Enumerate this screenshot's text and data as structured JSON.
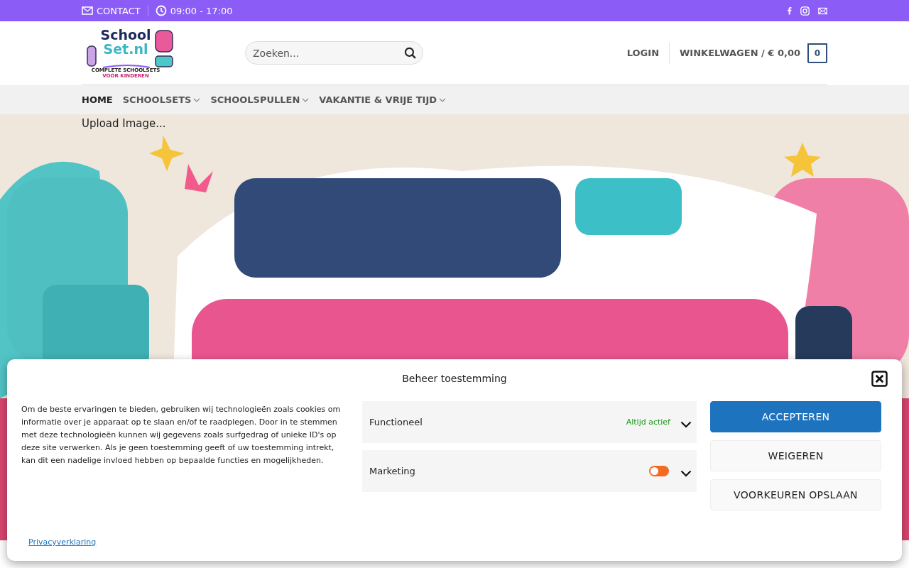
{
  "top_bar": {
    "contact": "CONTACT",
    "hours": "09:00 - 17:00"
  },
  "logo": {
    "line_1": "School",
    "line_2": "Set.nl",
    "tagline_1": "COMPLETE SCHOOLSETS",
    "tagline_2": "VOOR KINDEREN"
  },
  "search": {
    "placeholder": "Zoeken..."
  },
  "account": {
    "login": "LOGIN",
    "cart": "WINKELWAGEN / € 0,00",
    "cart_count": "0"
  },
  "nav": [
    {
      "label": "HOME",
      "selected": true,
      "dropdown": false
    },
    {
      "label": "SCHOOLSETS",
      "selected": false,
      "dropdown": true
    },
    {
      "label": "SCHOOLSPULLEN",
      "selected": false,
      "dropdown": true
    },
    {
      "label": "VAKANTIE & VRIJE TIJD",
      "selected": false,
      "dropdown": true
    }
  ],
  "hero": {
    "kind": "picture",
    "caption": "Upload Image..."
  },
  "consent": {
    "title": "Beheer toestemming",
    "text": "Om de beste ervaringen te bieden, gebruiken wij technologieën zoals cookies om informatie over je apparaat op te slaan en/of te raadplegen. Door in te stemmen met deze technologieën kunnen wij gegevens zoals surfgedrag of unieke ID's op deze site verwerken. Als je geen toestemming geeft of uw toestemming intrekt, kan dit een nadelige invloed hebben op bepaalde functies en mogelijkheden.",
    "categories": [
      {
        "name": "Functioneel",
        "kind": "always",
        "status": "Altijd actief"
      },
      {
        "name": "Marketing",
        "kind": "toggle",
        "on": false
      }
    ],
    "buttons": [
      {
        "label": "ACCEPTEREN",
        "primary": true
      },
      {
        "label": "WEIGEREN",
        "primary": false
      },
      {
        "label": "VOORKEUREN OPSLAAN",
        "primary": false
      }
    ],
    "privacy_link": "Privacyverklaring"
  }
}
